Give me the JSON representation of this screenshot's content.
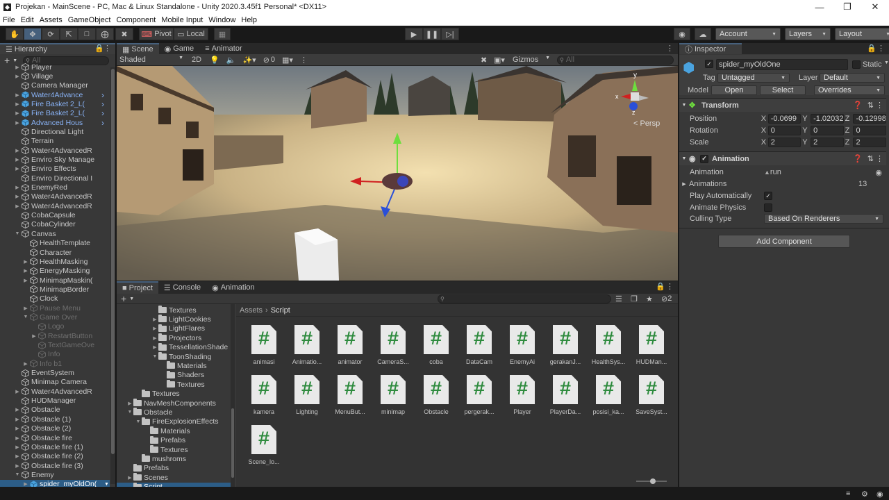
{
  "window": {
    "title": "Projekan - MainScene - PC, Mac & Linux Standalone - Unity 2020.3.45f1 Personal* <DX11>"
  },
  "menu": [
    "File",
    "Edit",
    "Assets",
    "GameObject",
    "Component",
    "Mobile Input",
    "Window",
    "Help"
  ],
  "toolbar": {
    "pivot": "Pivot",
    "local": "Local",
    "account": "Account",
    "layers": "Layers",
    "layout": "Layout"
  },
  "hierarchy": {
    "title": "Hierarchy",
    "search_placeholder": "All",
    "items": [
      {
        "label": "Player",
        "indent": 0,
        "fold": "collapsed",
        "type": "go"
      },
      {
        "label": "Village",
        "indent": 0,
        "fold": "collapsed",
        "type": "go"
      },
      {
        "label": "Camera Manager",
        "indent": 0,
        "fold": "none",
        "type": "go"
      },
      {
        "label": "Water4Advance",
        "indent": 0,
        "fold": "collapsed",
        "type": "prefab",
        "arrow": true
      },
      {
        "label": "Fire Basket 2_L(",
        "indent": 0,
        "fold": "collapsed",
        "type": "prefab",
        "arrow": true
      },
      {
        "label": "Fire Basket 2_L(",
        "indent": 0,
        "fold": "collapsed",
        "type": "prefab",
        "arrow": true
      },
      {
        "label": "Advanced Hous",
        "indent": 0,
        "fold": "collapsed",
        "type": "prefab",
        "arrow": true
      },
      {
        "label": "Directional Light",
        "indent": 0,
        "fold": "none",
        "type": "go"
      },
      {
        "label": "Terrain",
        "indent": 0,
        "fold": "none",
        "type": "go"
      },
      {
        "label": "Water4AdvancedR",
        "indent": 0,
        "fold": "collapsed",
        "type": "go"
      },
      {
        "label": "Enviro Sky Manage",
        "indent": 0,
        "fold": "collapsed",
        "type": "go"
      },
      {
        "label": "Enviro Effects",
        "indent": 0,
        "fold": "collapsed",
        "type": "go"
      },
      {
        "label": "Enviro Directional I",
        "indent": 0,
        "fold": "none",
        "type": "go"
      },
      {
        "label": "EnemyRed",
        "indent": 0,
        "fold": "collapsed",
        "type": "go"
      },
      {
        "label": "Water4AdvancedR",
        "indent": 0,
        "fold": "collapsed",
        "type": "go"
      },
      {
        "label": "Water4AdvancedR",
        "indent": 0,
        "fold": "collapsed",
        "type": "go"
      },
      {
        "label": "CobaCapsule",
        "indent": 0,
        "fold": "none",
        "type": "go"
      },
      {
        "label": "CobaCylinder",
        "indent": 0,
        "fold": "none",
        "type": "go"
      },
      {
        "label": "Canvas",
        "indent": 0,
        "fold": "expanded",
        "type": "go"
      },
      {
        "label": "HealthTemplate",
        "indent": 1,
        "fold": "none",
        "type": "go"
      },
      {
        "label": "Character",
        "indent": 1,
        "fold": "none",
        "type": "go"
      },
      {
        "label": "HealthMasking",
        "indent": 1,
        "fold": "collapsed",
        "type": "go"
      },
      {
        "label": "EnergyMasking",
        "indent": 1,
        "fold": "collapsed",
        "type": "go"
      },
      {
        "label": "MinimapMaskin(",
        "indent": 1,
        "fold": "collapsed",
        "type": "go"
      },
      {
        "label": "MinimapBorder",
        "indent": 1,
        "fold": "none",
        "type": "go"
      },
      {
        "label": "Clock",
        "indent": 1,
        "fold": "none",
        "type": "go"
      },
      {
        "label": "Pause Menu",
        "indent": 1,
        "fold": "collapsed",
        "type": "go",
        "disabled": true
      },
      {
        "label": "Game Over",
        "indent": 1,
        "fold": "expanded",
        "type": "go",
        "disabled": true
      },
      {
        "label": "Logo",
        "indent": 2,
        "fold": "none",
        "type": "go",
        "disabled": true
      },
      {
        "label": "RestartButton",
        "indent": 2,
        "fold": "collapsed",
        "type": "go",
        "disabled": true
      },
      {
        "label": "TextGameOve",
        "indent": 2,
        "fold": "none",
        "type": "go",
        "disabled": true
      },
      {
        "label": "Info",
        "indent": 2,
        "fold": "none",
        "type": "go",
        "disabled": true
      },
      {
        "label": "Info b1",
        "indent": 1,
        "fold": "collapsed",
        "type": "go",
        "disabled": true
      },
      {
        "label": "EventSystem",
        "indent": 0,
        "fold": "none",
        "type": "go"
      },
      {
        "label": "Minimap Camera",
        "indent": 0,
        "fold": "none",
        "type": "go"
      },
      {
        "label": "Water4AdvancedR",
        "indent": 0,
        "fold": "collapsed",
        "type": "go"
      },
      {
        "label": "HUDManager",
        "indent": 0,
        "fold": "none",
        "type": "go"
      },
      {
        "label": "Obstacle",
        "indent": 0,
        "fold": "collapsed",
        "type": "go"
      },
      {
        "label": "Obstacle (1)",
        "indent": 0,
        "fold": "collapsed",
        "type": "go"
      },
      {
        "label": "Obstacle (2)",
        "indent": 0,
        "fold": "collapsed",
        "type": "go"
      },
      {
        "label": "Obstacle fire",
        "indent": 0,
        "fold": "collapsed",
        "type": "go"
      },
      {
        "label": "Obstacle fire (1)",
        "indent": 0,
        "fold": "collapsed",
        "type": "go"
      },
      {
        "label": "Obstacle fire (2)",
        "indent": 0,
        "fold": "collapsed",
        "type": "go"
      },
      {
        "label": "Obstacle fire (3)",
        "indent": 0,
        "fold": "collapsed",
        "type": "go"
      },
      {
        "label": "Enemy",
        "indent": 0,
        "fold": "expanded",
        "type": "go"
      },
      {
        "label": "spider_myOldOn(",
        "indent": 1,
        "fold": "collapsed",
        "type": "prefab",
        "selected": true
      }
    ]
  },
  "scene": {
    "tabs": [
      "Scene",
      "Game",
      "Animator"
    ],
    "shading": "Shaded",
    "mode2d": "2D",
    "hidden_count": "0",
    "gizmos": "Gizmos",
    "search_placeholder": "All",
    "persp": "< Persp"
  },
  "project": {
    "tabs": [
      "Project",
      "Console",
      "Animation"
    ],
    "badge_count": "2",
    "breadcrumb": [
      "Assets",
      "Script"
    ],
    "tree": [
      {
        "label": "Textures",
        "indent": 3,
        "fold": "none"
      },
      {
        "label": "LightCookies",
        "indent": 3,
        "fold": "collapsed"
      },
      {
        "label": "LightFlares",
        "indent": 3,
        "fold": "collapsed"
      },
      {
        "label": "Projectors",
        "indent": 3,
        "fold": "collapsed"
      },
      {
        "label": "TessellationShade",
        "indent": 3,
        "fold": "collapsed"
      },
      {
        "label": "ToonShading",
        "indent": 3,
        "fold": "expanded"
      },
      {
        "label": "Materials",
        "indent": 4,
        "fold": "none"
      },
      {
        "label": "Shaders",
        "indent": 4,
        "fold": "none"
      },
      {
        "label": "Textures",
        "indent": 4,
        "fold": "none"
      },
      {
        "label": "Textures",
        "indent": 1,
        "fold": "none"
      },
      {
        "label": "NavMeshComponents",
        "indent": 0,
        "fold": "collapsed"
      },
      {
        "label": "Obstacle",
        "indent": 0,
        "fold": "expanded"
      },
      {
        "label": "FireExplosionEffects",
        "indent": 1,
        "fold": "expanded"
      },
      {
        "label": "Materials",
        "indent": 2,
        "fold": "none"
      },
      {
        "label": "Prefabs",
        "indent": 2,
        "fold": "none"
      },
      {
        "label": "Textures",
        "indent": 2,
        "fold": "none"
      },
      {
        "label": "mushroms",
        "indent": 1,
        "fold": "none"
      },
      {
        "label": "Prefabs",
        "indent": 0,
        "fold": "none"
      },
      {
        "label": "Scenes",
        "indent": 0,
        "fold": "collapsed"
      },
      {
        "label": "Script",
        "indent": 0,
        "fold": "none",
        "selected": true
      }
    ],
    "assets": [
      "animasi",
      "Animatio...",
      "animator",
      "CameraS...",
      "coba",
      "DataCam",
      "EnemyAi",
      "gerakanJ...",
      "HealthSys...",
      "HUDMan...",
      "kamera",
      "Lighting",
      "MenuBut...",
      "minimap",
      "Obstacle",
      "pergerak...",
      "Player",
      "PlayerDa...",
      "posisi_ka...",
      "SaveSyst...",
      "Scene_lo..."
    ]
  },
  "inspector": {
    "title": "Inspector",
    "object_name": "spider_myOldOne",
    "static_label": "Static",
    "tag_label": "Tag",
    "tag_value": "Untagged",
    "layer_label": "Layer",
    "layer_value": "Default",
    "model_label": "Model",
    "open": "Open",
    "select": "Select",
    "overrides": "Overrides",
    "transform": {
      "title": "Transform",
      "position_label": "Position",
      "rotation_label": "Rotation",
      "scale_label": "Scale",
      "position": [
        "-0.0699",
        "-1.02032",
        "-0.12998"
      ],
      "rotation": [
        "0",
        "0",
        "0"
      ],
      "scale": [
        "2",
        "2",
        "2"
      ],
      "axes": [
        "X",
        "Y",
        "Z"
      ]
    },
    "animation": {
      "title": "Animation",
      "animation_label": "Animation",
      "animation_value": "run",
      "animations_label": "Animations",
      "animations_count": "13",
      "play_auto_label": "Play Automatically",
      "play_auto": true,
      "animate_physics_label": "Animate Physics",
      "animate_physics": false,
      "culling_label": "Culling Type",
      "culling_value": "Based On Renderers"
    },
    "add_component": "Add Component"
  },
  "colors": {
    "accent": "#46607c",
    "prefab_text": "#8ab4f8",
    "selection": "#2c5d87",
    "script_hash": "#2e8b3e"
  }
}
